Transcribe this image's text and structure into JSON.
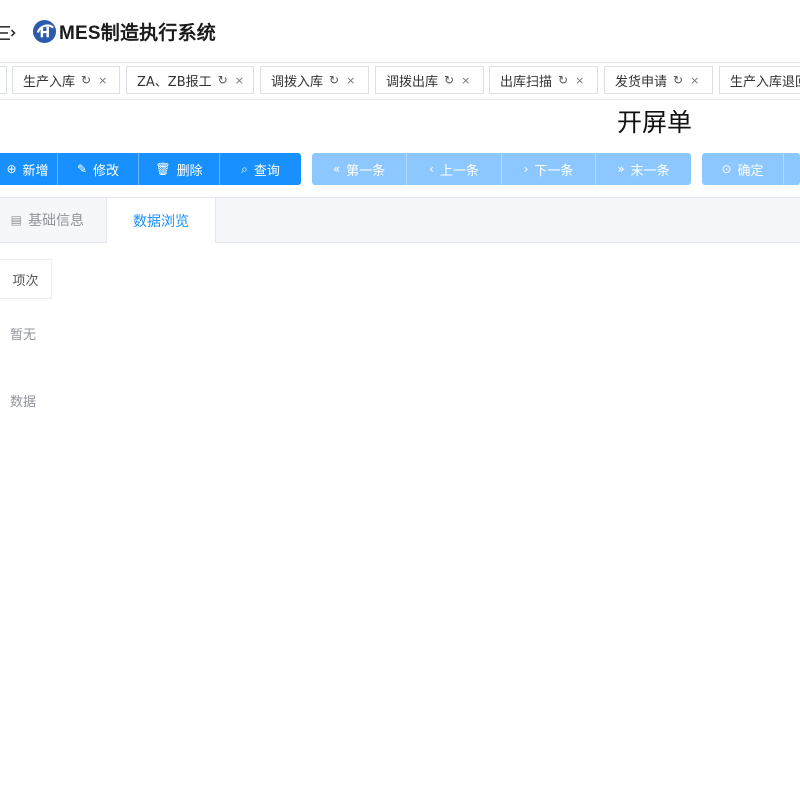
{
  "header": {
    "app_title_ascii": "MES",
    "app_title_cjk": "制造执行系统"
  },
  "open_tabs": [
    {
      "label": "生产入库",
      "refresh": "↻",
      "close": "×"
    },
    {
      "label": "ZA、ZB报工",
      "refresh": "↻",
      "close": "×"
    },
    {
      "label": "调拨入库",
      "refresh": "↻",
      "close": "×"
    },
    {
      "label": "调拨出库",
      "refresh": "↻",
      "close": "×"
    },
    {
      "label": "出库扫描",
      "refresh": "↻",
      "close": "×"
    },
    {
      "label": "发货申请",
      "refresh": "↻",
      "close": "×"
    },
    {
      "label": "生产入库退回"
    }
  ],
  "form": {
    "title": "开屏单"
  },
  "toolbar": {
    "primary": [
      {
        "icon": "⊕",
        "label": "新增"
      },
      {
        "icon": "✎",
        "label": "修改"
      },
      {
        "icon": "🗑",
        "label": "删除"
      },
      {
        "icon": "⌕",
        "label": "查询"
      }
    ],
    "navigation": [
      {
        "icon": "«",
        "label": "第一条"
      },
      {
        "icon": "‹",
        "label": "上一条"
      },
      {
        "icon": "›",
        "label": "下一条"
      },
      {
        "icon": "»",
        "label": "末一条"
      }
    ],
    "confirm": {
      "icon": "⊙",
      "label": "确定"
    }
  },
  "content_tabs": [
    {
      "icon": "▤",
      "label": "基础信息"
    },
    {
      "label": "数据浏览"
    }
  ],
  "grid": {
    "columns": [
      "项次"
    ],
    "empty_text_line1": "暂无",
    "empty_text_line2": "数据"
  },
  "colors": {
    "primary": "#1890ff",
    "disabled": "#8cc8ff"
  }
}
